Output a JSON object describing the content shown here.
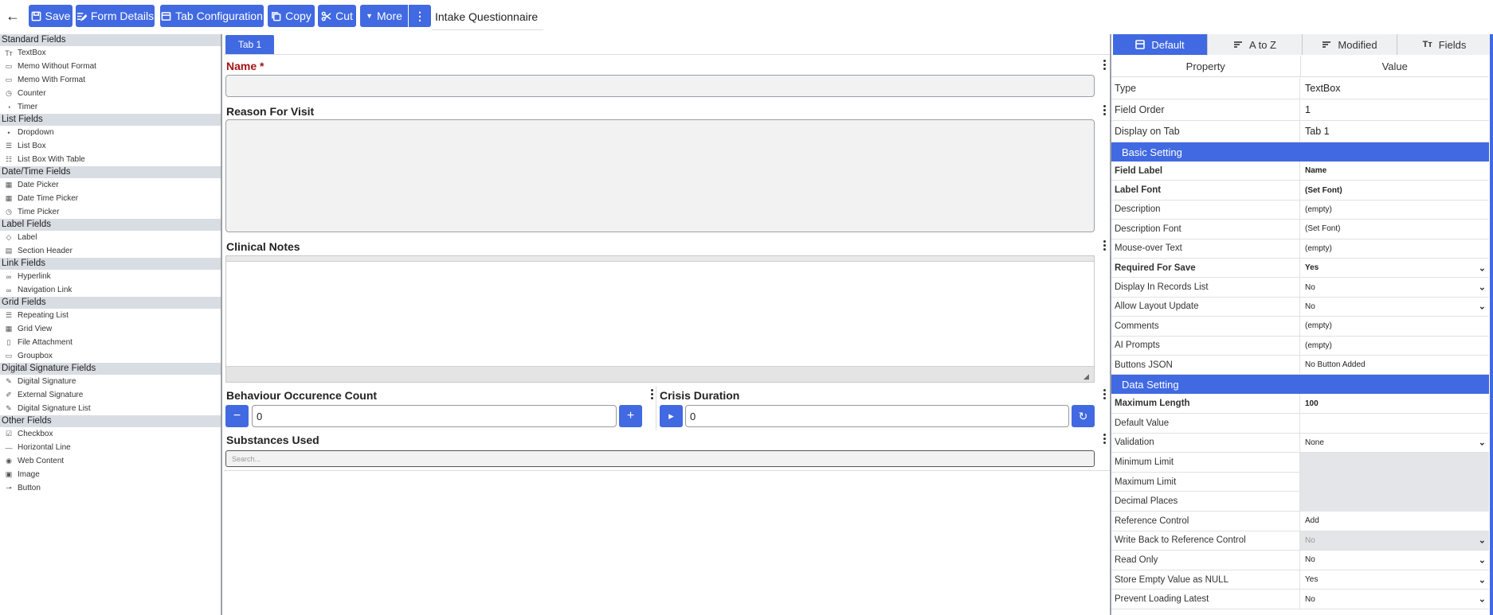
{
  "toolbar": {
    "back_icon": "arrow-left-icon",
    "save": "Save",
    "form_details": "Form Details",
    "tab_configuration": "Tab Configuration",
    "copy": "Copy",
    "cut": "Cut",
    "more": "More",
    "form_title": "Intake Questionnaire",
    "accent": "#4169e1"
  },
  "palette": {
    "categories": [
      {
        "name": "Standard Fields",
        "items": [
          {
            "icon": "Tт",
            "label": "TextBox"
          },
          {
            "icon": "▭",
            "label": "Memo Without Format"
          },
          {
            "icon": "▭",
            "label": "Memo With Format"
          },
          {
            "icon": "◷",
            "label": "Counter"
          },
          {
            "icon": "◔",
            "label": "Timer"
          }
        ]
      },
      {
        "name": "List Fields",
        "items": [
          {
            "icon": "•",
            "label": "Dropdown"
          },
          {
            "icon": "☰",
            "label": "List Box"
          },
          {
            "icon": "☷",
            "label": "List Box With Table"
          }
        ]
      },
      {
        "name": "Date/Time Fields",
        "items": [
          {
            "icon": "▦",
            "label": "Date Picker"
          },
          {
            "icon": "▦",
            "label": "Date Time Picker"
          },
          {
            "icon": "◷",
            "label": "Time Picker"
          }
        ]
      },
      {
        "name": "Label Fields",
        "items": [
          {
            "icon": "◇",
            "label": "Label"
          },
          {
            "icon": "▤",
            "label": "Section Header"
          }
        ]
      },
      {
        "name": "Link Fields",
        "items": [
          {
            "icon": "∞",
            "label": "Hyperlink"
          },
          {
            "icon": "∞",
            "label": "Navigation Link"
          }
        ]
      },
      {
        "name": "Grid Fields",
        "items": [
          {
            "icon": "☰",
            "label": "Repeating List"
          },
          {
            "icon": "▦",
            "label": "Grid View"
          },
          {
            "icon": "▯",
            "label": "File Attachment"
          },
          {
            "icon": "▭",
            "label": "Groupbox"
          }
        ]
      },
      {
        "name": "Digital Signature Fields",
        "items": [
          {
            "icon": "✎",
            "label": "Digital Signature"
          },
          {
            "icon": "✐",
            "label": "External Signature"
          },
          {
            "icon": "✎",
            "label": "Digital Signature List"
          }
        ]
      },
      {
        "name": "Other Fields",
        "items": [
          {
            "icon": "☑",
            "label": "Checkbox"
          },
          {
            "icon": "—",
            "label": "Horizontal Line"
          },
          {
            "icon": "◉",
            "label": "Web Content"
          },
          {
            "icon": "▣",
            "label": "Image"
          },
          {
            "icon": "⊸",
            "label": "Button"
          }
        ]
      }
    ]
  },
  "canvas": {
    "tab_label": "Tab 1",
    "name_label": "Name *",
    "reason_label": "Reason For Visit",
    "notes_label": "Clinical Notes",
    "behaviour_label": "Behaviour Occurence Count",
    "behaviour_value": "0",
    "crisis_label": "Crisis Duration",
    "crisis_value": "0",
    "substances_label": "Substances Used",
    "substances_placeholder": "Search...",
    "minus_glyph": "−",
    "plus_glyph": "+",
    "play_glyph": "▸",
    "reset_glyph": "↻",
    "required_color": "#a31515"
  },
  "props": {
    "tabs": [
      "Default",
      "A to Z",
      "Modified",
      "Fields"
    ],
    "col_property": "Property",
    "col_value": "Value",
    "general": [
      {
        "k": "Type",
        "v": "TextBox"
      },
      {
        "k": "Field Order",
        "v": "1"
      },
      {
        "k": "Display on Tab",
        "v": "Tab 1"
      }
    ],
    "basic_header": "Basic Setting",
    "basic": [
      {
        "k": "Field Label",
        "v": "Name"
      },
      {
        "k": "Label Font",
        "v": "(Set Font)"
      },
      {
        "k": "Description",
        "v": "(empty)"
      },
      {
        "k": "Description Font",
        "v": "(Set Font)"
      },
      {
        "k": "Mouse-over Text",
        "v": "(empty)"
      },
      {
        "k": "Required For Save",
        "v": "Yes"
      },
      {
        "k": "Display In Records List",
        "v": "No"
      },
      {
        "k": "Allow Layout Update",
        "v": "No"
      },
      {
        "k": "Comments",
        "v": "(empty)"
      },
      {
        "k": "AI Prompts",
        "v": "(empty)"
      },
      {
        "k": "Buttons JSON",
        "v": "No Button Added"
      }
    ],
    "data_header": "Data Setting",
    "data": [
      {
        "k": "Maximum Length",
        "v": "100"
      },
      {
        "k": "Default Value",
        "v": ""
      },
      {
        "k": "Validation",
        "v": "None"
      },
      {
        "k": "Minimum Limit",
        "v": ""
      },
      {
        "k": "Maximum Limit",
        "v": ""
      },
      {
        "k": "Decimal Places",
        "v": ""
      },
      {
        "k": "Reference Control",
        "v": "Add"
      },
      {
        "k": "Write Back to Reference Control",
        "v": "No"
      },
      {
        "k": "Read Only",
        "v": "No"
      },
      {
        "k": "Store Empty Value as NULL",
        "v": "Yes"
      },
      {
        "k": "Prevent Loading Latest",
        "v": "No"
      }
    ]
  }
}
